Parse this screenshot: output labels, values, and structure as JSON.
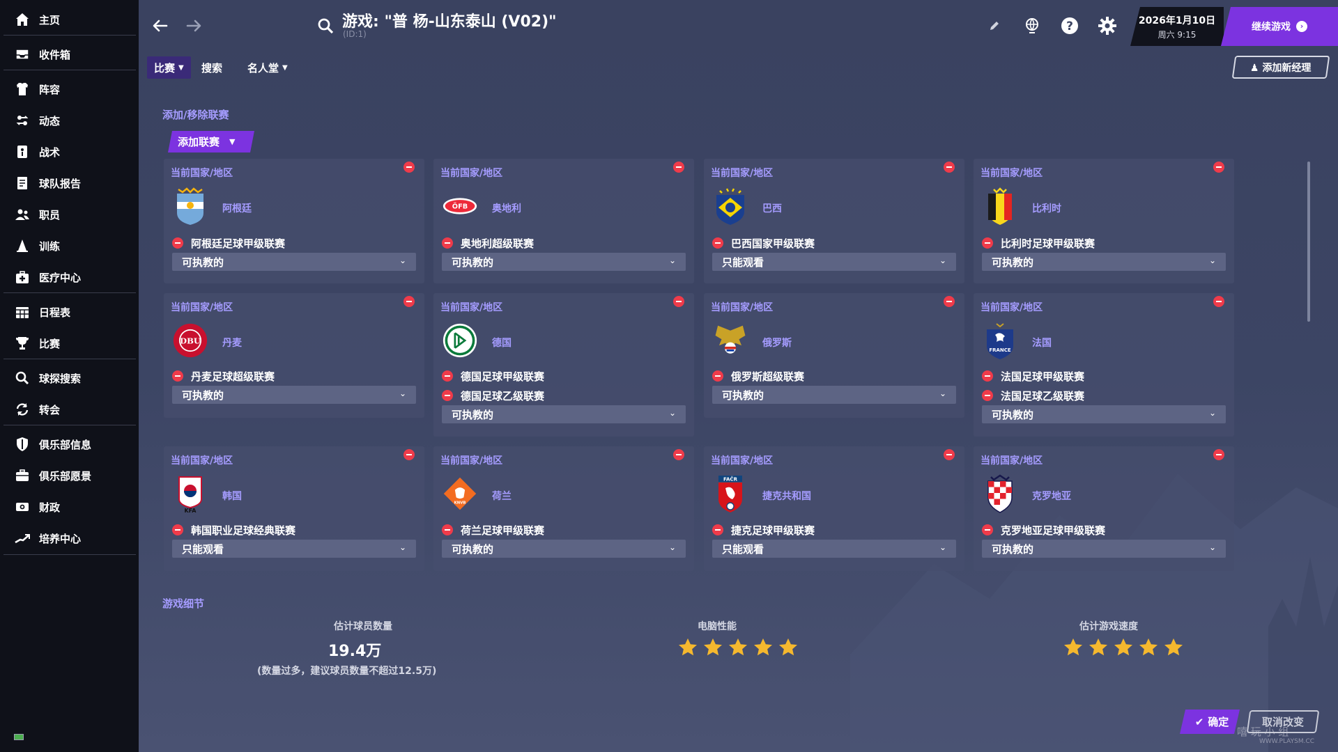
{
  "sidebar": {
    "items": [
      {
        "label": "主页",
        "icon": "home-icon"
      },
      {
        "label": "收件箱",
        "icon": "inbox-icon"
      },
      {
        "label": "阵容",
        "icon": "jersey-icon"
      },
      {
        "label": "动态",
        "icon": "dynamics-icon"
      },
      {
        "label": "战术",
        "icon": "tactics-board-icon"
      },
      {
        "label": "球队报告",
        "icon": "report-icon"
      },
      {
        "label": "职员",
        "icon": "staff-icon"
      },
      {
        "label": "训练",
        "icon": "training-cone-icon"
      },
      {
        "label": "医疗中心",
        "icon": "medical-kit-icon"
      },
      {
        "label": "日程表",
        "icon": "calendar-icon"
      },
      {
        "label": "比赛",
        "icon": "trophy-icon"
      },
      {
        "label": "球探搜索",
        "icon": "search-icon"
      },
      {
        "label": "转会",
        "icon": "transfer-arrows-icon"
      },
      {
        "label": "俱乐部信息",
        "icon": "shield-icon"
      },
      {
        "label": "俱乐部愿景",
        "icon": "briefcase-icon"
      },
      {
        "label": "财政",
        "icon": "money-icon"
      },
      {
        "label": "培养中心",
        "icon": "growth-chart-icon"
      }
    ]
  },
  "header": {
    "title": "游戏: \"普 杨-山东泰山 (V02)\"",
    "subtitle": "(ID:1)",
    "date": "2026年1月10日",
    "weekday_time": "周六 9:15",
    "continue_label": "继续游戏"
  },
  "tabs": [
    {
      "label": "比赛",
      "has_dropdown": true,
      "active": true
    },
    {
      "label": "搜索",
      "has_dropdown": false,
      "active": false
    },
    {
      "label": "名人堂",
      "has_dropdown": true,
      "active": false
    }
  ],
  "add_manager_label": "添加新经理",
  "leagues_section": {
    "title": "添加/移除联赛",
    "add_label": "添加联赛",
    "cards": [
      {
        "label": "当前国家/地区",
        "country": "阿根廷",
        "crest": "argentina-crest-icon",
        "leagues": [
          "阿根廷足球甲级联赛"
        ],
        "mode": "可执教的"
      },
      {
        "label": "当前国家/地区",
        "country": "奥地利",
        "crest": "austria-crest-icon",
        "leagues": [
          "奥地利超级联赛"
        ],
        "mode": "可执教的"
      },
      {
        "label": "当前国家/地区",
        "country": "巴西",
        "crest": "brazil-crest-icon",
        "leagues": [
          "巴西国家甲级联赛"
        ],
        "mode": "只能观看"
      },
      {
        "label": "当前国家/地区",
        "country": "比利时",
        "crest": "belgium-crest-icon",
        "leagues": [
          "比利时足球甲级联赛"
        ],
        "mode": "可执教的"
      },
      {
        "label": "当前国家/地区",
        "country": "丹麦",
        "crest": "denmark-crest-icon",
        "leagues": [
          "丹麦足球超级联赛"
        ],
        "mode": "可执教的"
      },
      {
        "label": "当前国家/地区",
        "country": "德国",
        "crest": "germany-crest-icon",
        "leagues": [
          "德国足球甲级联赛",
          "德国足球乙级联赛"
        ],
        "mode": "可执教的"
      },
      {
        "label": "当前国家/地区",
        "country": "俄罗斯",
        "crest": "russia-crest-icon",
        "leagues": [
          "俄罗斯超级联赛"
        ],
        "mode": "可执教的"
      },
      {
        "label": "当前国家/地区",
        "country": "法国",
        "crest": "france-crest-icon",
        "leagues": [
          "法国足球甲级联赛",
          "法国足球乙级联赛"
        ],
        "mode": "可执教的"
      },
      {
        "label": "当前国家/地区",
        "country": "韩国",
        "crest": "korea-crest-icon",
        "leagues": [
          "韩国职业足球经典联赛"
        ],
        "mode": "只能观看"
      },
      {
        "label": "当前国家/地区",
        "country": "荷兰",
        "crest": "netherlands-crest-icon",
        "leagues": [
          "荷兰足球甲级联赛"
        ],
        "mode": "可执教的"
      },
      {
        "label": "当前国家/地区",
        "country": "捷克共和国",
        "crest": "czech-crest-icon",
        "leagues": [
          "捷克足球甲级联赛"
        ],
        "mode": "只能观看"
      },
      {
        "label": "当前国家/地区",
        "country": "克罗地亚",
        "crest": "croatia-crest-icon",
        "leagues": [
          "克罗地亚足球甲级联赛"
        ],
        "mode": "可执教的"
      }
    ]
  },
  "game_details": {
    "title": "游戏细节",
    "players_label": "估计球员数量",
    "players_value": "19.4万",
    "players_note": "(数量过多，建议球员数量不超过12.5万)",
    "performance_label": "电脑性能",
    "performance_stars": 5,
    "speed_label": "估计游戏速度",
    "speed_stars": 5
  },
  "footer": {
    "ok_label": "确定",
    "cancel_label": "取消改变"
  },
  "watermark": {
    "text": "嘻 玩 小 组",
    "sub": "WWW.PLAYSM.CC"
  },
  "colors": {
    "accent": "#7c33e0",
    "label_purple": "#a59cff",
    "remove_red": "#ef3b4a",
    "star_gold": "#f5b82e",
    "sidebar_bg": "#0f1119"
  }
}
